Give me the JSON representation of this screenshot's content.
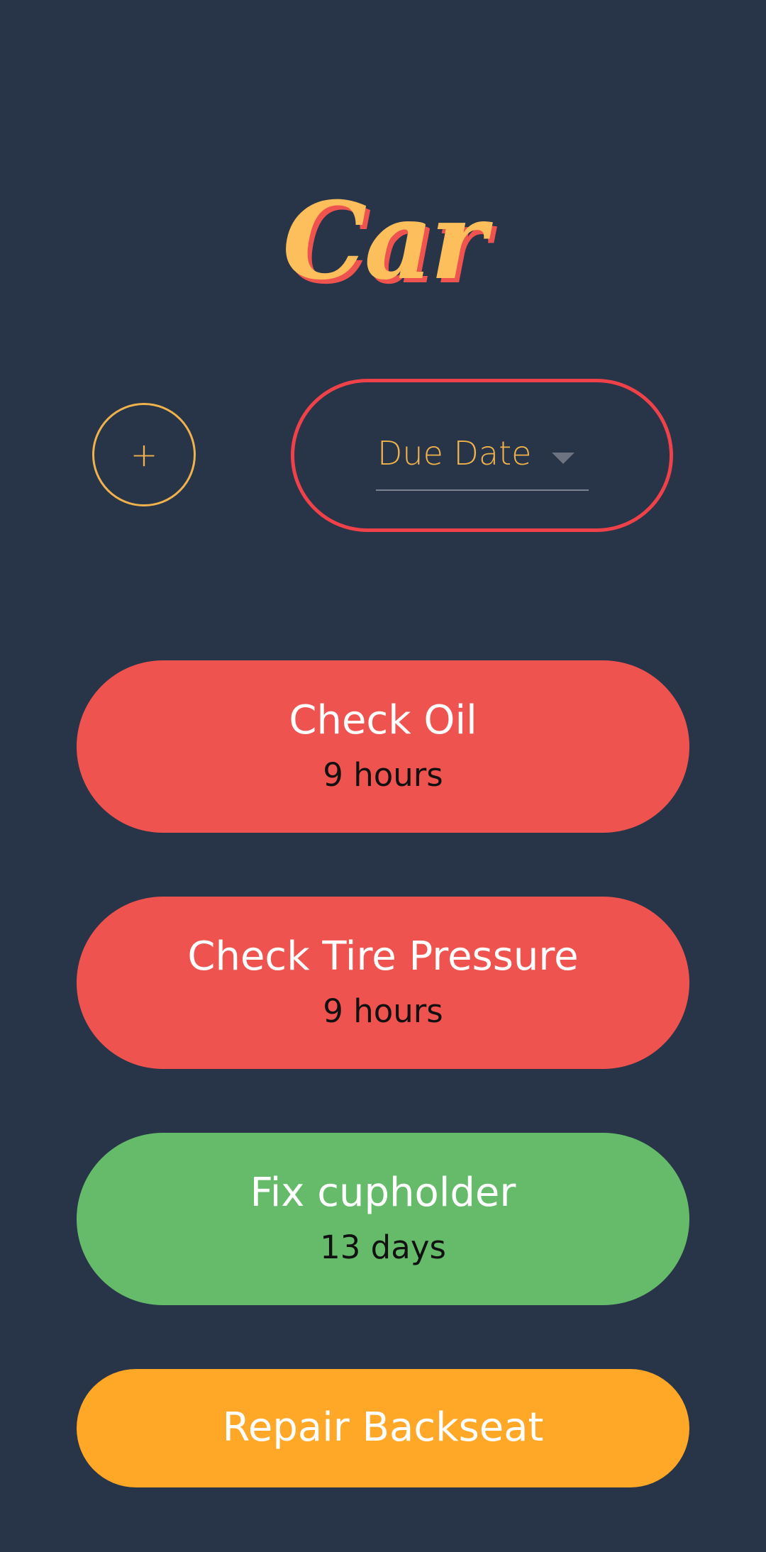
{
  "header": {
    "title": "Car"
  },
  "controls": {
    "add_label": "+",
    "add_icon": "plus-icon",
    "sort": {
      "selected": "Due Date",
      "dropdown_icon": "chevron-down-icon"
    }
  },
  "tasks": [
    {
      "title": "Check Oil",
      "due": "9 hours",
      "color": "#ee5350"
    },
    {
      "title": "Check Tire Pressure",
      "due": "9 hours",
      "color": "#ee5350"
    },
    {
      "title": "Fix cupholder",
      "due": "13 days",
      "color": "#66bb6a"
    },
    {
      "title": "Repair Backseat",
      "due": "",
      "color": "#ffa726"
    }
  ],
  "colors": {
    "background": "#283447",
    "title": "#fcbf5c",
    "title_shadow": "#ee5350",
    "accent_yellow": "#f0b24c",
    "accent_red": "#ee4149"
  }
}
